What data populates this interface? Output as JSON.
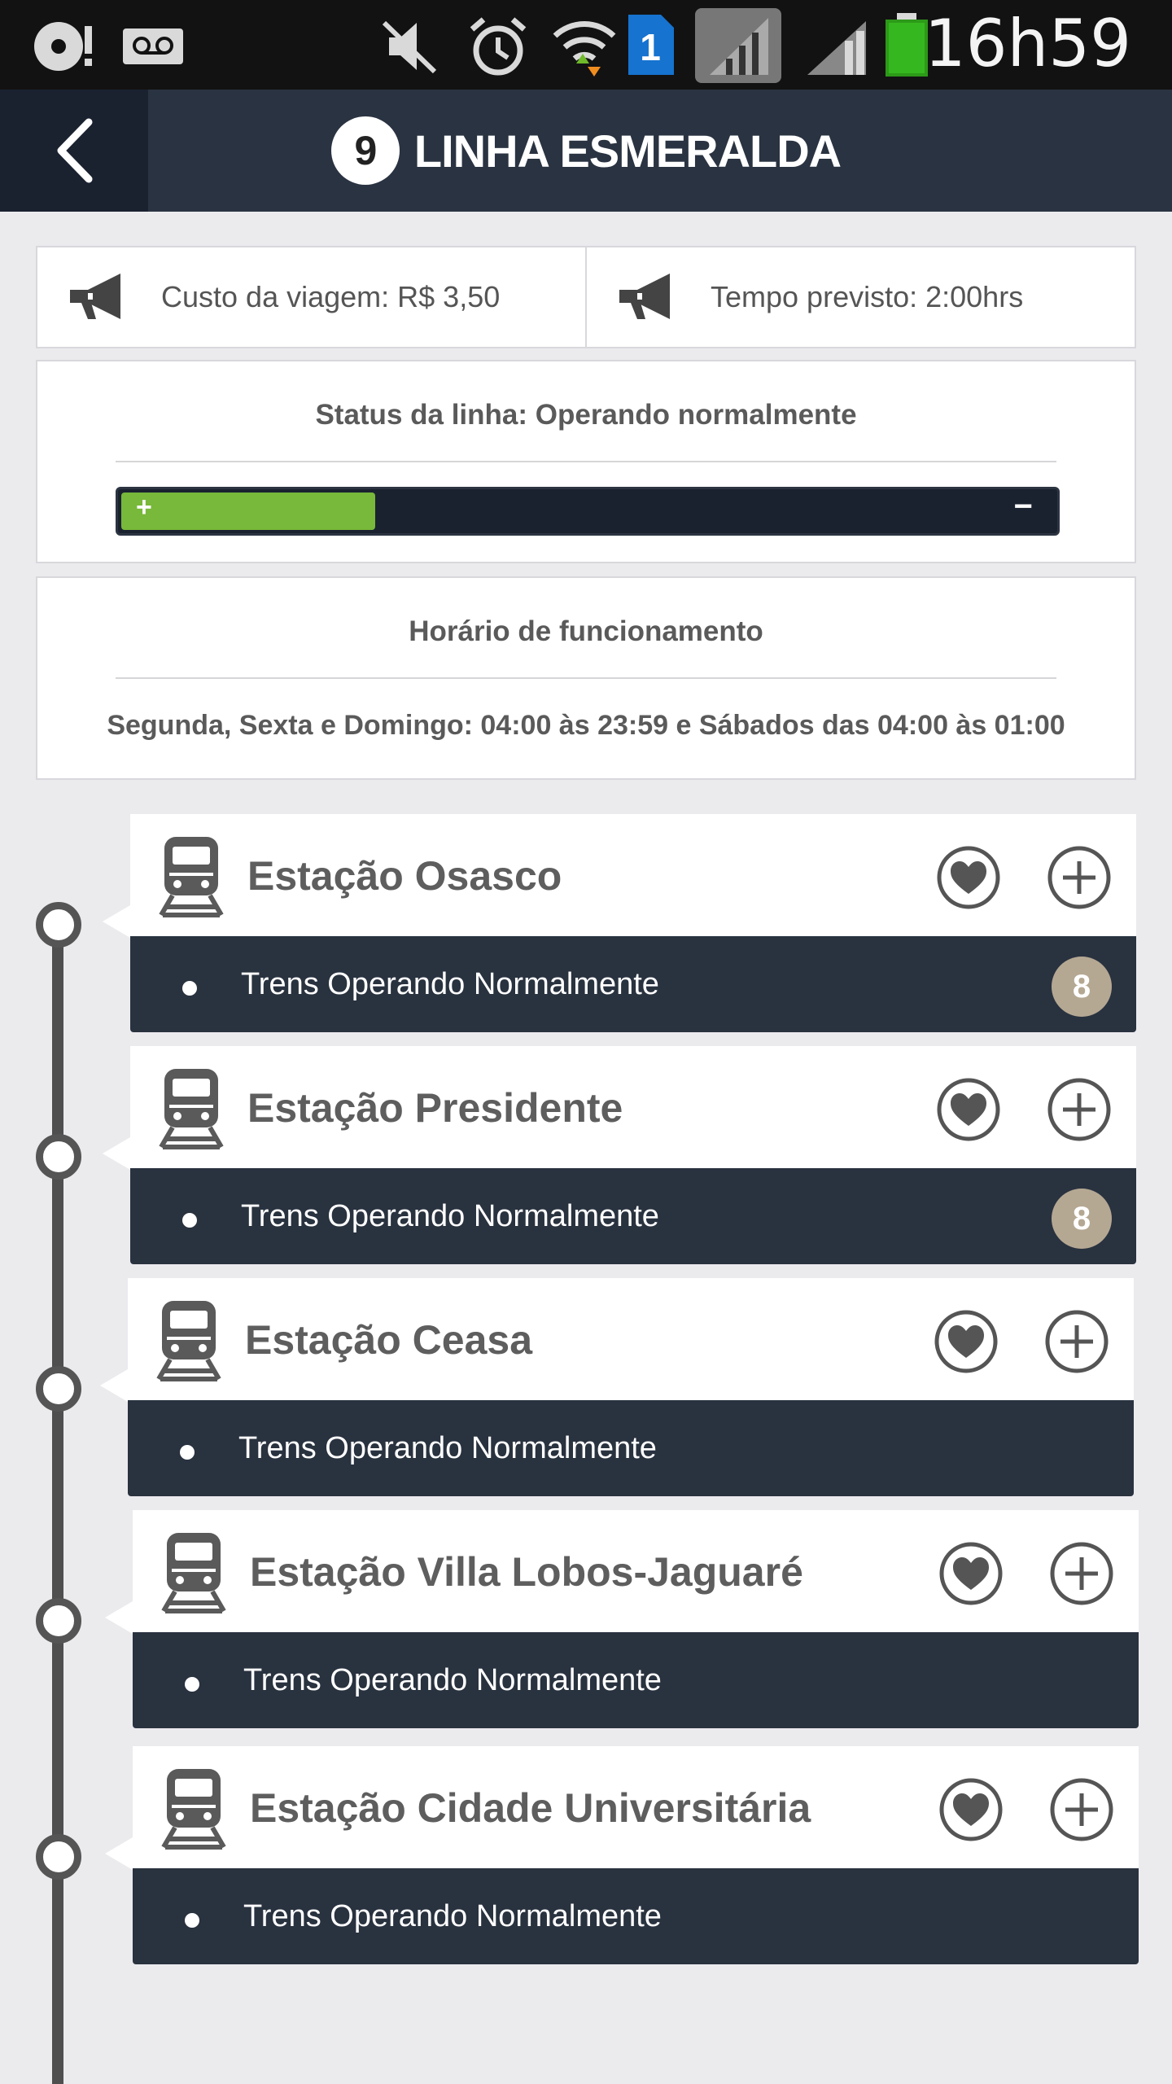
{
  "status_bar": {
    "time": "16h59",
    "icons": [
      "media-icon",
      "voicemail-icon",
      "mute-icon",
      "alarm-icon",
      "wifi-icon",
      "sim1-icon",
      "signal-icon",
      "signal-icon",
      "battery-icon"
    ],
    "sim_label": "1"
  },
  "header": {
    "line_number": "9",
    "title": "LINHA ESMERALDA",
    "color": "#2a3341"
  },
  "info": {
    "cost_label": "Custo da viagem: R$ 3,50",
    "time_label": "Tempo previsto: 2:00hrs"
  },
  "line_status": {
    "title": "Status da linha: Operando normalmente",
    "level_fraction": 0.27,
    "plus": "+",
    "minus": "−",
    "fill_color": "#78b83a"
  },
  "schedule": {
    "title": "Horário de funcionamento",
    "text": "Segunda, Sexta e Domingo: 04:00 às 23:59 e Sábados das 04:00 às 01:00"
  },
  "stations": [
    {
      "name": "Estação Osasco",
      "status": "Trens Operando Normalmente",
      "badge": "8"
    },
    {
      "name": "Estação Presidente",
      "status": "Trens Operando Normalmente",
      "badge": "8"
    },
    {
      "name": "Estação Ceasa",
      "status": "Trens Operando Normalmente",
      "badge": ""
    },
    {
      "name": "Estação Villa Lobos-Jaguaré",
      "status": "Trens Operando Normalmente",
      "badge": ""
    },
    {
      "name": "Estação Cidade Universitária",
      "status": "Trens Operando Normalmente",
      "badge": ""
    }
  ]
}
